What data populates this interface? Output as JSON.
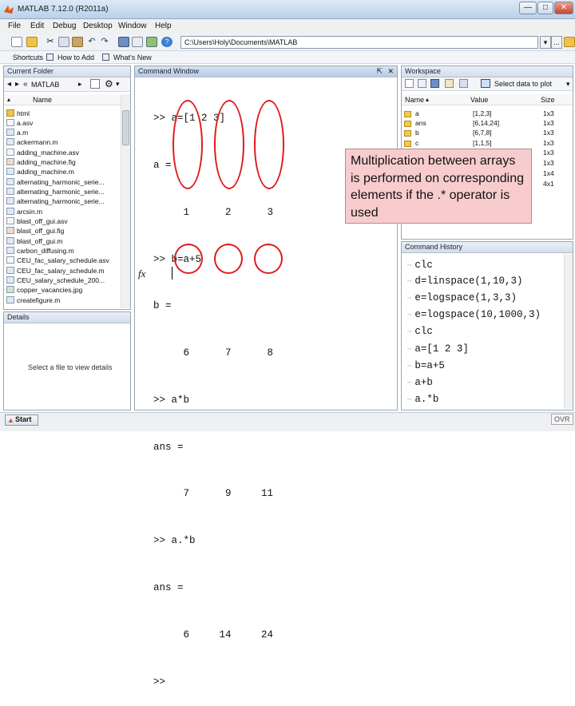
{
  "window": {
    "title": "MATLAB 7.12.0 (R2011a)",
    "min_glyph": "—",
    "max_glyph": "□",
    "close_glyph": "✕"
  },
  "menu": [
    "File",
    "Edit",
    "Debug",
    "Desktop",
    "Window",
    "Help"
  ],
  "toolbar": {
    "current_path": "C:\\Users\\Holy\\Documents\\MATLAB",
    "browse_label": "...",
    "help_label": "?",
    "icons": [
      "new-file-icon",
      "open-folder-icon",
      "cut-icon",
      "copy-icon",
      "paste-icon",
      "undo-icon",
      "redo-icon",
      "simulink-icon",
      "guide-icon",
      "profiler-icon",
      "help-icon"
    ]
  },
  "shortcuts": {
    "shortcuts_label": "Shortcuts",
    "how_to_add": "How to Add",
    "whats_new": "What's New"
  },
  "current_folder": {
    "title": "Current Folder",
    "location": "MATLAB",
    "column_name": "Name",
    "files": [
      "html",
      "a.asv",
      "a.m",
      "ackermann.m",
      "adding_machine.asv",
      "adding_machine.fig",
      "adding_machine.m",
      "alternating_harmonic_serie...",
      "alternating_harmonic_serie...",
      "alternating_harmonic_serie...",
      "arcsin.m",
      "blast_off_gui.asv",
      "blast_off_gui.fig",
      "blast_off_gui.m",
      "carbon_diffusing.m",
      "CEU_fac_salary_schedule.asv",
      "CEU_fac_salary_schedule.m",
      "CEU_salary_schedule_200...",
      "copper_vacancies.jpg",
      "createfigure.m"
    ]
  },
  "details": {
    "title": "Details",
    "hint": "Select a file to view details"
  },
  "command_window": {
    "title": "Command Window",
    "lines": [
      ">> a=[1 2 3]",
      "a =",
      "     1      2      3",
      ">> b=a+5",
      "b =",
      "     6      7      8",
      ">> a*b",
      "ans =",
      "     7      9     11",
      ">> a.*b",
      "ans =",
      "     6     14     24",
      ">> "
    ],
    "fx_label": "fx"
  },
  "workspace": {
    "title": "Workspace",
    "select_plot": "Select data to plot",
    "columns": [
      "Name",
      "Value",
      "Size"
    ],
    "variables": [
      {
        "name": "a",
        "value": "[1,2,3]",
        "size": "1x3"
      },
      {
        "name": "ans",
        "value": "[6,14,24]",
        "size": "1x3"
      },
      {
        "name": "b",
        "value": "[6,7,8]",
        "size": "1x3"
      },
      {
        "name": "c",
        "value": "[1,1,5]",
        "size": "1x3"
      },
      {
        "name": "",
        "value": "",
        "size": "1x3"
      },
      {
        "name": "",
        "value": "",
        "size": "1x3"
      },
      {
        "name": "",
        "value": "",
        "size": "1x4"
      },
      {
        "name": "",
        "value": "",
        "size": "4x1"
      }
    ]
  },
  "annotation": {
    "text": "Multiplication between arrays is performed on corresponding elements if the .* operator is used",
    "ring_color": "#e01b1b"
  },
  "history": {
    "title": "Command History",
    "entries": [
      "clc",
      "d=linspace(1,10,3)",
      "e=logspace(1,3,3)",
      "e=logspace(10,1000,3)",
      "clc",
      "a=[1 2 3]",
      "b=a+5",
      "a+b",
      "a.*b"
    ]
  },
  "status": {
    "start_label": "Start",
    "ovr_label": "OVR"
  }
}
